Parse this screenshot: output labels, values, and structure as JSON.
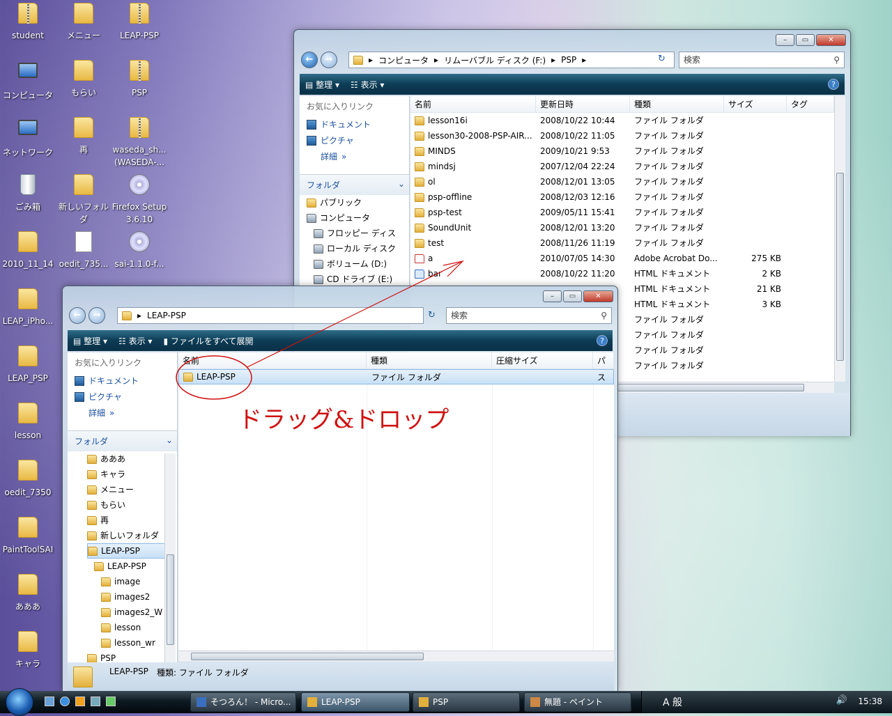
{
  "desktop": {
    "icons": [
      {
        "label": "student",
        "kind": "zip"
      },
      {
        "label": "メニュー",
        "kind": "folder"
      },
      {
        "label": "LEAP-PSP",
        "kind": "zip"
      },
      {
        "label": "コンピュータ",
        "kind": "pc"
      },
      {
        "label": "もらい",
        "kind": "folder"
      },
      {
        "label": "PSP",
        "kind": "zip"
      },
      {
        "label": "ネットワーク",
        "kind": "pc"
      },
      {
        "label": "再",
        "kind": "folder"
      },
      {
        "label": "waseda_sh...\n(WASEDA-...",
        "kind": "zip"
      },
      {
        "label": "ごみ箱",
        "kind": "trash"
      },
      {
        "label": "新しいフォルダ",
        "kind": "folder"
      },
      {
        "label": "Firefox Setup 3.6.10",
        "kind": "cd"
      },
      {
        "label": "2010_11_14",
        "kind": "folder"
      },
      {
        "label": "oedit_735...",
        "kind": "doc"
      },
      {
        "label": "sai-1.1.0-f...",
        "kind": "cd"
      },
      {
        "label": "LEAP_iPho...",
        "kind": "folder"
      },
      {
        "label": "LEAP_PSP",
        "kind": "folder"
      },
      {
        "label": "lesson",
        "kind": "folder"
      },
      {
        "label": "oedit_7350",
        "kind": "folder"
      },
      {
        "label": "PaintToolSAI",
        "kind": "folder"
      },
      {
        "label": "あああ",
        "kind": "folder"
      },
      {
        "label": "キャラ",
        "kind": "folder"
      }
    ]
  },
  "win1": {
    "path": [
      "コンピュータ",
      "リムーバブル ディスク (F:)",
      "PSP"
    ],
    "search_placeholder": "検索",
    "toolbar": {
      "organize": "整理",
      "views": "表示"
    },
    "fav_header": "お気に入りリンク",
    "favs": [
      "ドキュメント",
      "ピクチャ"
    ],
    "more": "詳細",
    "folders_header": "フォルダ",
    "tree": [
      "パブリック",
      "コンピュータ",
      "フロッピー ディス",
      "ローカル ディスク",
      "ボリューム (D:)",
      "CD ドライブ (E:)"
    ],
    "columns": [
      "名前",
      "更新日時",
      "種類",
      "サイズ",
      "タグ"
    ],
    "rows": [
      {
        "name": "lesson16i",
        "date": "2008/10/22 10:44",
        "type": "ファイル フォルダ",
        "size": "",
        "icon": "folder"
      },
      {
        "name": "lesson30-2008-PSP-AIR...",
        "date": "2008/10/22 11:05",
        "type": "ファイル フォルダ",
        "size": "",
        "icon": "folder"
      },
      {
        "name": "MINDS",
        "date": "2009/10/21 9:53",
        "type": "ファイル フォルダ",
        "size": "",
        "icon": "folder"
      },
      {
        "name": "mindsj",
        "date": "2007/12/04 22:24",
        "type": "ファイル フォルダ",
        "size": "",
        "icon": "folder"
      },
      {
        "name": "ol",
        "date": "2008/12/01 13:05",
        "type": "ファイル フォルダ",
        "size": "",
        "icon": "folder"
      },
      {
        "name": "psp-offline",
        "date": "2008/12/03 12:16",
        "type": "ファイル フォルダ",
        "size": "",
        "icon": "folder"
      },
      {
        "name": "psp-test",
        "date": "2009/05/11 15:41",
        "type": "ファイル フォルダ",
        "size": "",
        "icon": "folder"
      },
      {
        "name": "SoundUnit",
        "date": "2008/12/01 13:20",
        "type": "ファイル フォルダ",
        "size": "",
        "icon": "folder"
      },
      {
        "name": "test",
        "date": "2008/11/26 11:19",
        "type": "ファイル フォルダ",
        "size": "",
        "icon": "folder"
      },
      {
        "name": "a",
        "date": "2010/07/05 14:30",
        "type": "Adobe Acrobat Do...",
        "size": "275 KB",
        "icon": "pdf"
      },
      {
        "name": "bar",
        "date": "2008/10/22 11:20",
        "type": "HTML ドキュメント",
        "size": "2 KB",
        "icon": "html"
      },
      {
        "name": "",
        "date": "",
        "type": "HTML ドキュメント",
        "size": "21 KB",
        "icon": ""
      },
      {
        "name": "",
        "date": "",
        "type": "HTML ドキュメント",
        "size": "3 KB",
        "icon": ""
      },
      {
        "name": "",
        "date": "",
        "type": "ファイル フォルダ",
        "size": "",
        "icon": ""
      },
      {
        "name": "",
        "date": "",
        "type": "ファイル フォルダ",
        "size": "",
        "icon": ""
      },
      {
        "name": "",
        "date": "",
        "type": "ファイル フォルダ",
        "size": "",
        "icon": ""
      },
      {
        "name": "",
        "date": "",
        "type": "ファイル フォルダ",
        "size": "",
        "icon": ""
      }
    ]
  },
  "win2": {
    "path": [
      "LEAP-PSP"
    ],
    "search_placeholder": "検索",
    "toolbar": {
      "organize": "整理",
      "views": "表示",
      "extract": "ファイルをすべて展開"
    },
    "fav_header": "お気に入りリンク",
    "favs": [
      "ドキュメント",
      "ピクチャ"
    ],
    "more": "詳細",
    "folders_header": "フォルダ",
    "tree": [
      {
        "label": "あああ",
        "indent": 0,
        "sel": false
      },
      {
        "label": "キャラ",
        "indent": 0,
        "sel": false
      },
      {
        "label": "メニュー",
        "indent": 0,
        "sel": false
      },
      {
        "label": "もらい",
        "indent": 0,
        "sel": false
      },
      {
        "label": "再",
        "indent": 0,
        "sel": false
      },
      {
        "label": "新しいフォルダ",
        "indent": 0,
        "sel": false
      },
      {
        "label": "LEAP-PSP",
        "indent": 0,
        "sel": true
      },
      {
        "label": "LEAP-PSP",
        "indent": 1,
        "sel": false
      },
      {
        "label": "image",
        "indent": 2,
        "sel": false
      },
      {
        "label": "images2",
        "indent": 2,
        "sel": false
      },
      {
        "label": "images2_W",
        "indent": 2,
        "sel": false
      },
      {
        "label": "lesson",
        "indent": 2,
        "sel": false
      },
      {
        "label": "lesson_wr",
        "indent": 2,
        "sel": false
      },
      {
        "label": "PSP",
        "indent": 0,
        "sel": false
      }
    ],
    "columns": [
      "名前",
      "種類",
      "圧縮サイズ",
      "パス"
    ],
    "rows": [
      {
        "name": "LEAP-PSP",
        "type": "ファイル フォルダ"
      }
    ],
    "status_name": "LEAP-PSP",
    "status_type": "種類: ファイル フォルダ"
  },
  "annotation": "ドラッグ&ドロップ",
  "taskbar": {
    "tasks": [
      "そつろん！ - Micro...",
      "LEAP-PSP",
      "PSP",
      "無題 - ペイント"
    ],
    "clock": "15:38",
    "tray_text": "A 般"
  },
  "colors": {
    "annotation": "#d01010",
    "link": "#1a4fa0"
  }
}
